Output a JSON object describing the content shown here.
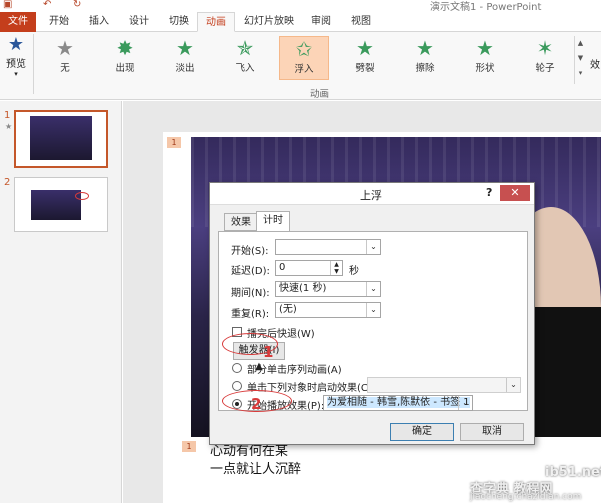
{
  "window": {
    "title": "演示文稿1 - PowerPoint"
  },
  "tabs": [
    {
      "label": "文件"
    },
    {
      "label": "开始"
    },
    {
      "label": "插入"
    },
    {
      "label": "设计"
    },
    {
      "label": "切换"
    },
    {
      "label": "动画"
    },
    {
      "label": "幻灯片放映"
    },
    {
      "label": "审阅"
    },
    {
      "label": "视图"
    }
  ],
  "ribbon": {
    "preview_label": "预览",
    "effects": [
      {
        "label": "无",
        "icon": "star-none-icon"
      },
      {
        "label": "出现",
        "icon": "star-appear-icon"
      },
      {
        "label": "淡出",
        "icon": "star-fade-icon"
      },
      {
        "label": "飞入",
        "icon": "star-fly-icon"
      },
      {
        "label": "浮入",
        "icon": "star-float-icon",
        "selected": true
      },
      {
        "label": "劈裂",
        "icon": "star-split-icon"
      },
      {
        "label": "擦除",
        "icon": "star-wipe-icon"
      },
      {
        "label": "形状",
        "icon": "star-shape-icon"
      },
      {
        "label": "轮子",
        "icon": "star-wheel-icon"
      }
    ],
    "overflow_label": "效",
    "group_label": "动画"
  },
  "thumbnails": [
    {
      "num": "1"
    },
    {
      "num": "2"
    }
  ],
  "slide": {
    "anim_tag_1": "1",
    "anim_tag_2": "1",
    "text_line1": "心动有何在某",
    "text_line2": "一点就让人沉醉"
  },
  "dialog": {
    "title": "上浮",
    "help": "?",
    "close": "✕",
    "tabs": [
      {
        "label": "效果"
      },
      {
        "label": "计时"
      }
    ],
    "active_tab": "计时",
    "start_label": "开始(S):",
    "start_value": "",
    "delay_label": "延迟(D):",
    "delay_value": "0",
    "delay_unit": "秒",
    "duration_label": "期间(N):",
    "duration_value": "快速(1 秒)",
    "repeat_label": "重复(R):",
    "repeat_value": "(无)",
    "rewind_label": "播完后快退(W)",
    "trigger_label": "触发器(I)",
    "trigger_arrow": "▲",
    "opt_sequence": "部分单击序列动画(A)",
    "opt_click": "单击下列对象时启动效果(C):",
    "opt_play": "开始播放效果(P):",
    "play_value": "为爱相随 - 韩雪,陈默依 - 书签 1",
    "ok_label": "确定",
    "cancel_label": "取消",
    "marker_1": "1",
    "marker_2": "2"
  },
  "watermark": {
    "line1": "ib51.net",
    "line2": "查字典 教程网",
    "line3": "jiaocheng.chazidian.com"
  }
}
